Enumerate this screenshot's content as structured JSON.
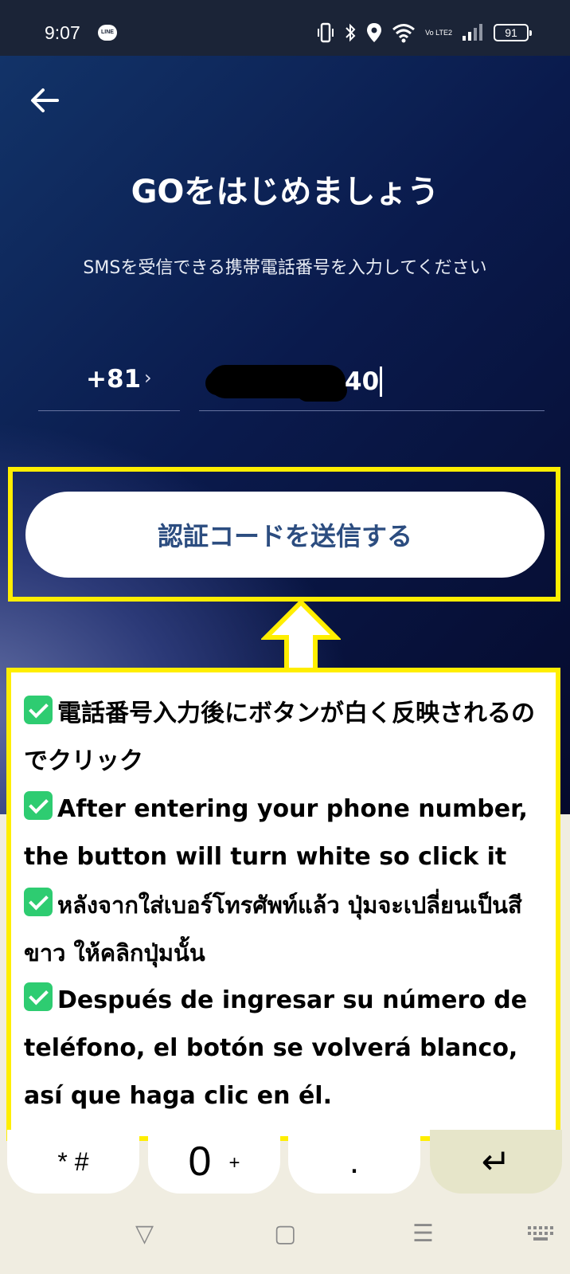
{
  "status_bar": {
    "time": "9:07",
    "line_icon_label": "LINE",
    "battery": "91",
    "volte": "Vo LTE2"
  },
  "app": {
    "title": "GOをはじめましょう",
    "subtitle": "SMSを受信できる携帯電話番号を入力してください",
    "country_code": "+81",
    "country_chevron": "›",
    "phone_visible": "40",
    "send_button": "認証コードを送信する"
  },
  "callout": {
    "items": [
      "電話番号入力後にボタンが白く反映されるのでクリック",
      "After entering your phone number, the button will turn white so click it",
      "หลังจากใส่เบอร์โทรศัพท์แล้ว ปุ่มจะเปลี่ยนเป็นสีขาว ให้คลิกปุ่มนั้น",
      "Después de ingresar su número de teléfono, el botón se volverá blanco, así que haga clic en él."
    ]
  },
  "keyboard": {
    "key_star": "* #",
    "key_zero": "0",
    "key_zero_sub": "+",
    "key_dot": ".",
    "key_enter": "↵"
  },
  "nav": {
    "back": "▽",
    "home": "▢",
    "menu": "☰"
  },
  "colors": {
    "highlight": "#ffee00",
    "check": "#2ecc71",
    "button_text": "#2c4d80"
  }
}
